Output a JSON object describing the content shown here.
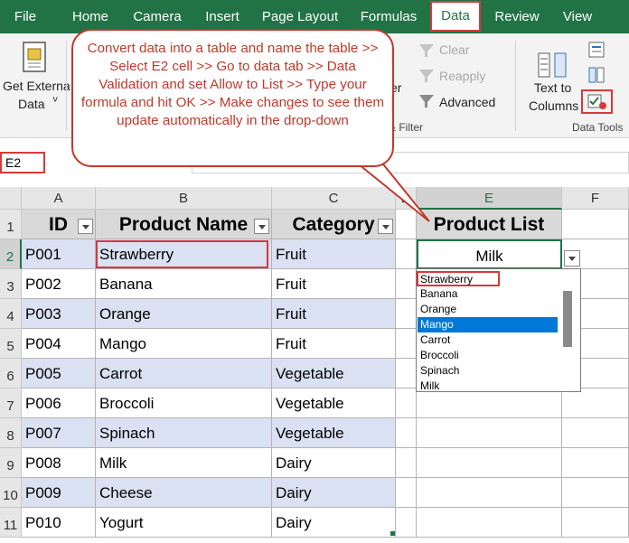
{
  "ribbon_tabs": [
    "File",
    "Home",
    "Camera",
    "Insert",
    "Page Layout",
    "Formulas",
    "Data",
    "Review",
    "View"
  ],
  "active_tab": "Data",
  "ribbon": {
    "get_external_line1": "Get Externa",
    "get_external_line2": "Data",
    "clear": "Clear",
    "reapply": "Reapply",
    "advanced": "Advanced",
    "er_fragment": "er",
    "filter_group": "& Filter",
    "text_to_line1": "Text to",
    "text_to_line2": "Columns",
    "data_tools": "Data Tools"
  },
  "formula_bar": {
    "name_box": "E2",
    "formula": ""
  },
  "callout": "Convert data into a table and name the table >> Select E2 cell >> Go to data tab >> Data Validation and set Allow to List >> Type your formula and hit OK >> Make changes to see them update automatically in the drop-down",
  "columns": [
    "A",
    "B",
    "C",
    "D",
    "E",
    "F"
  ],
  "rows": [
    "1",
    "2",
    "3",
    "4",
    "5",
    "6",
    "7",
    "8",
    "9",
    "10",
    "11"
  ],
  "table": {
    "headers": [
      "ID",
      "Product Name",
      "Category"
    ],
    "rows": [
      [
        "P001",
        "Strawberry",
        "Fruit"
      ],
      [
        "P002",
        "Banana",
        "Fruit"
      ],
      [
        "P003",
        "Orange",
        "Fruit"
      ],
      [
        "P004",
        "Mango",
        "Fruit"
      ],
      [
        "P005",
        "Carrot",
        "Vegetable"
      ],
      [
        "P006",
        "Broccoli",
        "Vegetable"
      ],
      [
        "P007",
        "Spinach",
        "Vegetable"
      ],
      [
        "P008",
        "Milk",
        "Dairy"
      ],
      [
        "P009",
        "Cheese",
        "Dairy"
      ],
      [
        "P010",
        "Yogurt",
        "Dairy"
      ]
    ]
  },
  "product_list": {
    "header": "Product List",
    "value": "Milk"
  },
  "dropdown": {
    "items": [
      "Strawberry",
      "Banana",
      "Orange",
      "Mango",
      "Carrot",
      "Broccoli",
      "Spinach",
      "Milk"
    ],
    "highlighted": "Mango"
  },
  "colors": {
    "excel_green": "#217346",
    "highlight_red": "#d9383a",
    "band_blue": "#d9e1f2",
    "select_blue": "#0078d7"
  }
}
